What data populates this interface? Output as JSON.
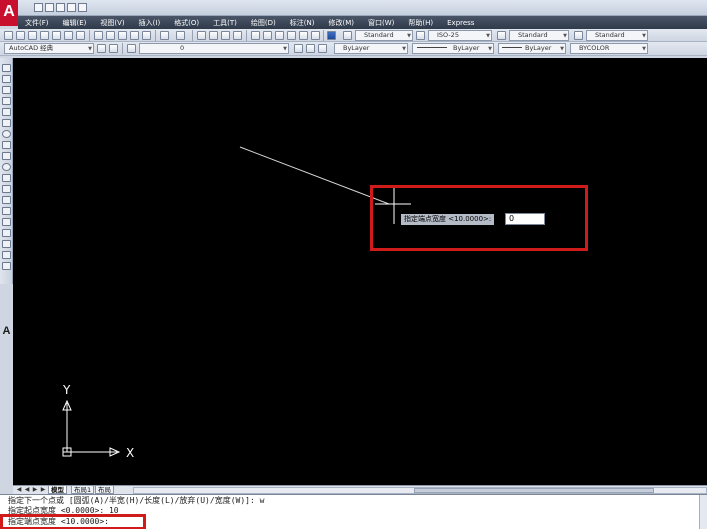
{
  "app": {
    "logo_letter": "A"
  },
  "menu": [
    "文件(F)",
    "编辑(E)",
    "视图(V)",
    "插入(I)",
    "格式(O)",
    "工具(T)",
    "绘图(D)",
    "标注(N)",
    "修改(M)",
    "窗口(W)",
    "帮助(H)",
    "Express"
  ],
  "toolbar1": {
    "text_style": "Standard",
    "dim_style": "ISO-25",
    "table_style": "Standard",
    "mleader_style": "Standard"
  },
  "toolbar2": {
    "workspace": "AutoCAD 经典",
    "layer": "0",
    "color": "ByLayer",
    "linetype": "ByLayer",
    "lineweight": "ByLayer",
    "plotstyle": "BYCOLOR"
  },
  "canvas": {
    "background": "#000000",
    "polyline_color": "#d8d8d8",
    "crosshair_color": "#ffffff",
    "ucs_x_label": "X",
    "ucs_y_label": "Y"
  },
  "dynamic_input": {
    "prompt": "指定端点宽度 <10.0000>:",
    "value": "0"
  },
  "tabs": {
    "model": "模型",
    "layout1": "布局1",
    "layout2": "布局"
  },
  "command_window": {
    "lines": [
      "指定下一个点或 [圆弧(A)/半宽(H)/长度(L)/放弃(U)/宽度(W)]: w",
      "指定起点宽度 <0.0000>: 10",
      "指定端点宽度 <10.0000>:"
    ]
  },
  "highlight_color": "#d01b1b"
}
